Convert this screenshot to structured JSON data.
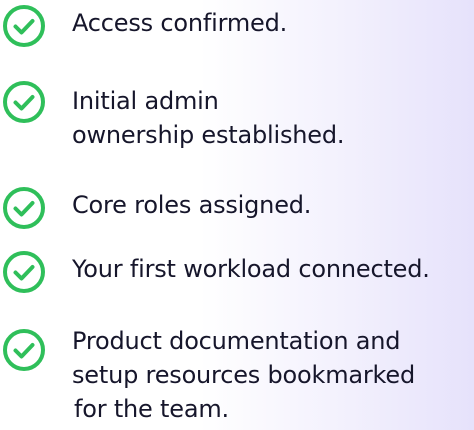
{
  "checklist": {
    "accent_color": "#2fbf5a",
    "icon": "check-circle-icon",
    "items": [
      {
        "lines": [
          "Access confirmed."
        ]
      },
      {
        "lines": [
          "Initial admin",
          "ownership established."
        ]
      },
      {
        "lines": [
          "Core roles assigned."
        ]
      },
      {
        "lines": [
          "Your first workload connected."
        ]
      },
      {
        "lines": [
          "Product documentation and",
          "setup resources bookmarked",
          "for the team."
        ]
      }
    ]
  }
}
